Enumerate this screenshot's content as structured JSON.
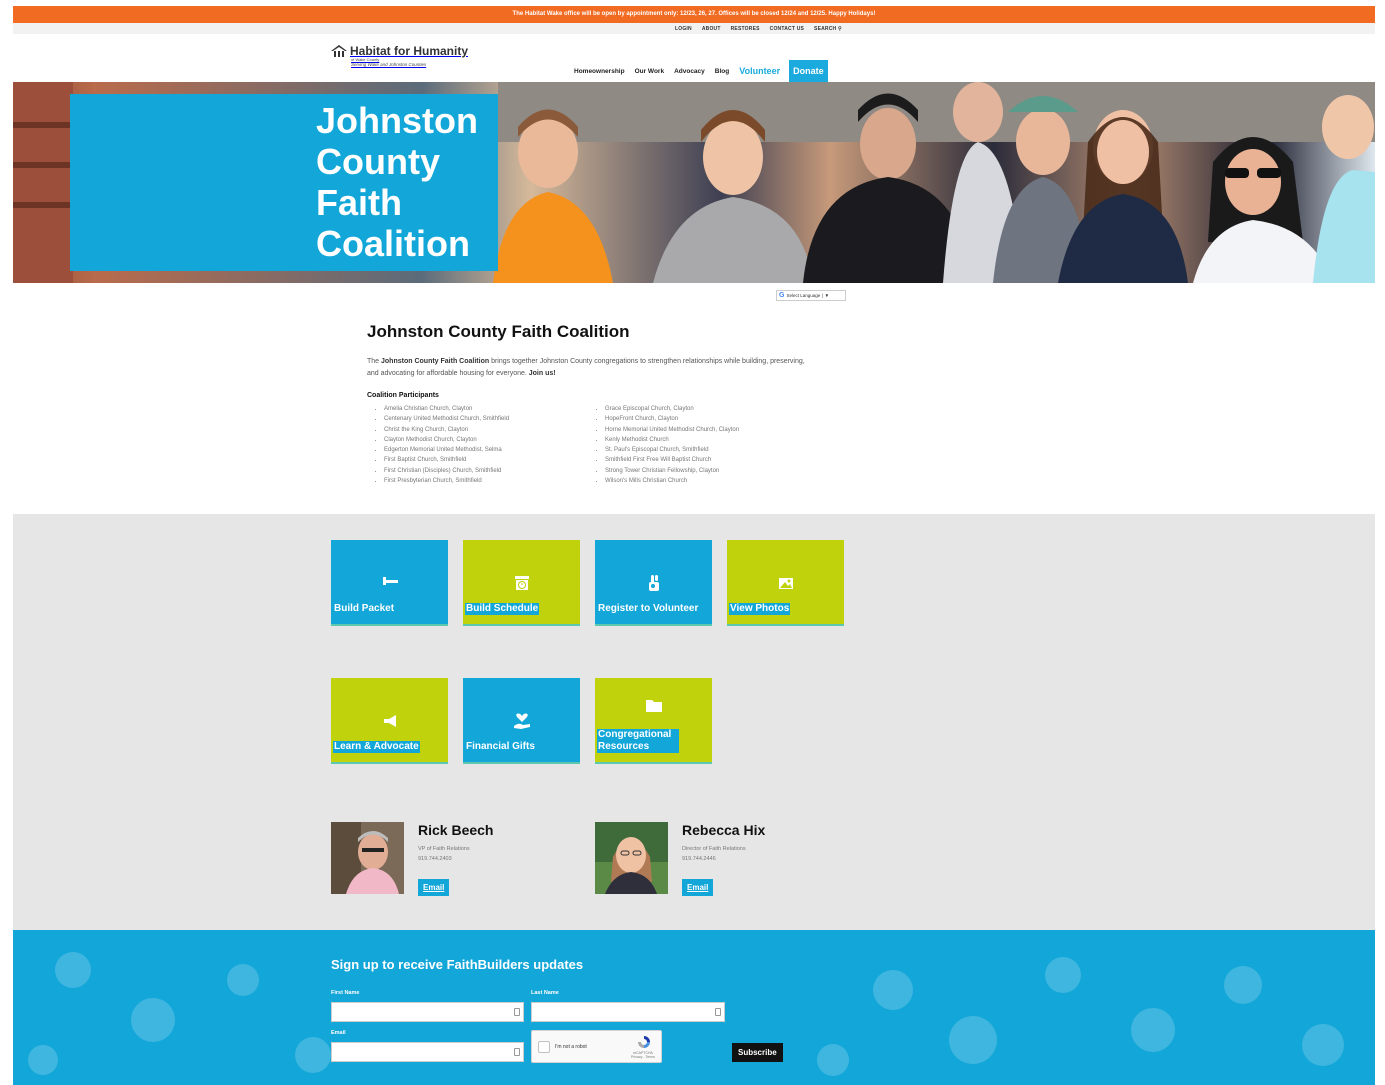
{
  "alert": {
    "text": "The Habitat Wake office will be open by appointment only: 12/23, 26, 27. Offices will be closed 12/24 and 12/25. Happy Holidays!"
  },
  "utility_nav": [
    "LOGIN",
    "ABOUT",
    "RESTORES",
    "CONTACT US",
    "SEARCH"
  ],
  "logo": {
    "name": "Habitat for Humanity",
    "affiliate": "of Wake County",
    "tagline": "Serving Wake and Johnston Counties"
  },
  "main_nav": {
    "homeownership": "Homeownership",
    "our_work": "Our Work",
    "advocacy": "Advocacy",
    "blog": "Blog",
    "volunteer": "Volunteer",
    "donate": "Donate"
  },
  "hero": {
    "title": "Johnston County Faith Coalition"
  },
  "translate": {
    "label": "Select Language"
  },
  "intro": {
    "heading": "Johnston County Faith Coalition",
    "text_start": "The ",
    "org_name": "Johnston County Faith Coalition",
    "text_mid": " brings together Johnston County congregations to strengthen relationships while building, preserving, and advocating for affordable housing for everyone. ",
    "cta": "Join us!",
    "participants_heading": "Coalition Participants",
    "participants_left": [
      "Amelia Christian Church, Clayton",
      "Centenary United Methodist Church, Smithfield",
      "Christ the King Church, Clayton",
      "Clayton Methodist Church, Clayton",
      "Edgerton Memorial United Methodist, Selma",
      "First Baptist Church, Smithfield",
      "First Christian (Disciples) Church, Smithfield",
      "First Presbyterian Church, Smithfield"
    ],
    "participants_right": [
      "Grace Episcopal Church, Clayton",
      "HopeFront Church, Clayton",
      "Horne Memorial United Methodist Church, Clayton",
      "Kenly Methodist Church",
      "St. Paul's Episcopal Church, Smithfield",
      "Smithfield First Free Will Baptist Church",
      "Strong Tower Christian Fellowship, Clayton",
      "Wilson's Mills Christian Church"
    ]
  },
  "tiles": [
    {
      "label": "Build Packet",
      "icon": "hammer-icon",
      "color": "#12a6d9"
    },
    {
      "label": "Build Schedule",
      "icon": "calendar-clock-icon",
      "color": "#c0d20c"
    },
    {
      "label": "Register to Volunteer",
      "icon": "hand-raised-icon",
      "color": "#12a6d9"
    },
    {
      "label": "View Photos",
      "icon": "photo-icon",
      "color": "#c0d20c"
    },
    {
      "label": "Learn & Advocate",
      "icon": "megaphone-icon",
      "color": "#c0d20c"
    },
    {
      "label": "Financial Gifts",
      "icon": "heart-hand-icon",
      "color": "#12a6d9"
    },
    {
      "label": "Congregational Resources",
      "icon": "folder-icon",
      "color": "#c0d20c"
    }
  ],
  "staff": [
    {
      "name": "Rick Beech",
      "title": "VP of Faith Relations",
      "phone": "919.744.2403",
      "email_label": "Email"
    },
    {
      "name": "Rebecca Hix",
      "title": "Director of Faith Relations",
      "phone": "919.744.2446",
      "email_label": "Email"
    }
  ],
  "signup": {
    "heading": "Sign up to receive FaithBuilders updates",
    "first_name_label": "First Name",
    "last_name_label": "Last Name",
    "email_label": "Email",
    "captcha_label": "I'm not a robot",
    "captcha_brand": "reCAPTCHA",
    "captcha_terms": "Privacy - Terms",
    "subscribe_label": "Subscribe"
  },
  "colors": {
    "alert_orange": "#f26b22",
    "brand_blue": "#12a6d9",
    "brand_green": "#c0d20c",
    "grey_section": "#e6e6e6"
  }
}
